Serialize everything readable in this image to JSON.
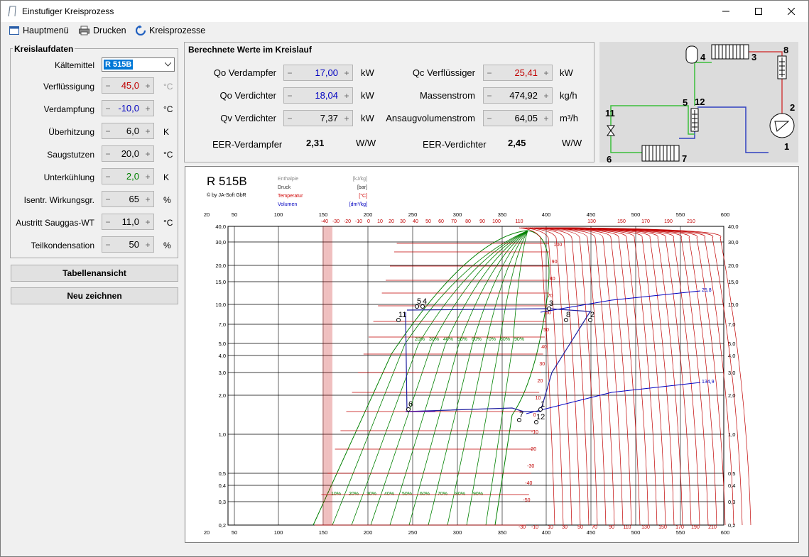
{
  "window": {
    "title": "Einstufiger Kreisprozess"
  },
  "menu": {
    "main": "Hauptmenü",
    "print": "Drucken",
    "processes": "Kreisprozesse"
  },
  "circuit_data": {
    "title": "Kreislaufdaten",
    "refrigerant_label": "Kältemittel",
    "refrigerant": "R 515B",
    "rows": [
      {
        "label": "Verflüssigung",
        "value": "45,0",
        "unit": "°C",
        "color": "#c00000"
      },
      {
        "label": "Verdampfung",
        "value": "-10,0",
        "unit": "°C",
        "color": "#0000c0"
      },
      {
        "label": "Überhitzung",
        "value": "6,0",
        "unit": "K",
        "color": "#000000"
      },
      {
        "label": "Saugstutzen",
        "value": "20,0",
        "unit": "°C",
        "color": "#000000"
      },
      {
        "label": "Unterkühlung",
        "value": "2,0",
        "unit": "K",
        "color": "#008000"
      },
      {
        "label": "Isentr. Wirkungsgr.",
        "value": "65",
        "unit": "%",
        "color": "#000000"
      },
      {
        "label": "Austritt Sauggas-WT",
        "value": "11,0",
        "unit": "°C",
        "color": "#000000"
      },
      {
        "label": "Teilkondensation",
        "value": "50",
        "unit": "%",
        "color": "#000000"
      }
    ],
    "btn_table": "Tabellenansicht",
    "btn_redraw": "Neu zeichnen"
  },
  "calc": {
    "title": "Berechnete Werte im Kreislauf",
    "left": [
      {
        "label": "Qo Verdampfer",
        "value": "17,00",
        "unit": "kW",
        "color": "#0000c0"
      },
      {
        "label": "Qo Verdichter",
        "value": "18,04",
        "unit": "kW",
        "color": "#0000c0"
      },
      {
        "label": "Qv Verdichter",
        "value": "7,37",
        "unit": "kW",
        "color": "#000000"
      }
    ],
    "right": [
      {
        "label": "Qc Verflüssiger",
        "value": "25,41",
        "unit": "kW",
        "color": "#c00000"
      },
      {
        "label": "Massenstrom",
        "value": "474,92",
        "unit": "kg/h",
        "color": "#000000"
      },
      {
        "label": "Ansaugvolumenstrom",
        "value": "64,05",
        "unit": "m³/h",
        "color": "#000000"
      }
    ],
    "eer_evap_label": "EER-Verdampfer",
    "eer_evap_value": "2,31",
    "eer_evap_unit": "W/W",
    "eer_comp_label": "EER-Verdichter",
    "eer_comp_value": "2,45",
    "eer_comp_unit": "W/W"
  },
  "schematic": {
    "labels": [
      "4",
      "3",
      "8",
      "2",
      "1",
      "5",
      "12",
      "11",
      "6",
      "7"
    ]
  },
  "diagram": {
    "title": "R 515B",
    "copyright": "© by JA-Soft GbR",
    "legend": [
      {
        "name": "Enthalpie",
        "unit": "[kJ/kg]",
        "color": "#888888"
      },
      {
        "name": "Druck",
        "unit": "[bar]",
        "color": "#333333"
      },
      {
        "name": "Temperatur",
        "unit": "[°C]",
        "color": "#d00000"
      },
      {
        "name": "Volumen",
        "unit": "[dm³/kg]",
        "color": "#0000c0"
      }
    ],
    "enthalpy_ticks": [
      "20",
      "50",
      "100",
      "150",
      "200",
      "250",
      "300",
      "350",
      "400",
      "450",
      "500",
      "550",
      "600"
    ],
    "pressure_ticks": [
      "40,0",
      "30,0",
      "20,0",
      "15,0",
      "10,0",
      "7,0",
      "5,0",
      "4,0",
      "3,0",
      "2,0",
      "1,0",
      "0,5",
      "0,4",
      "0,3",
      "0,2"
    ],
    "top_temp_ticks": [
      "-40",
      "-30",
      "-20",
      "-10",
      "0",
      "10",
      "20",
      "30",
      "40",
      "50",
      "60",
      "70",
      "80",
      "90",
      "100",
      "110"
    ],
    "top_temp_ticks_right": [
      "130",
      "150",
      "170",
      "190",
      "210"
    ],
    "bottom_temp_ticks": [
      "-30",
      "-10",
      "10",
      "30",
      "50",
      "70",
      "90",
      "110",
      "130",
      "150",
      "170",
      "190",
      "210"
    ],
    "quality_top": [
      "20%",
      "30%",
      "40%",
      "50%",
      "60%",
      "70%",
      "80%",
      "90%"
    ],
    "quality_bottom": [
      "10%",
      "20%",
      "30%",
      "40%",
      "50%",
      "60%",
      "70%",
      "80%",
      "90%"
    ],
    "iso_temp_labels": [
      "100",
      "90",
      "80",
      "70",
      "60",
      "50",
      "40",
      "30",
      "20",
      "10",
      "0",
      "-10",
      "-20",
      "-30",
      "-40",
      "-50"
    ],
    "volume_labels": [
      "25,8",
      "134,9"
    ],
    "point_labels": [
      "5",
      "4",
      "11",
      "3",
      "8",
      "2",
      "6",
      "1",
      "7",
      "12"
    ]
  }
}
